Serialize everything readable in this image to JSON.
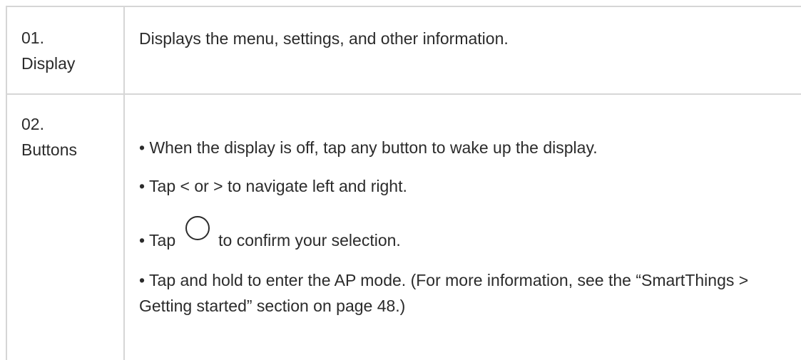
{
  "rows": [
    {
      "number": "01.",
      "name": "Display",
      "description": "Displays the menu, settings, and other information."
    },
    {
      "number": "02.",
      "name": "Buttons",
      "bullets": [
        "• When the display is off, tap any button to wake up the display.",
        "• Tap < or > to navigate left and right.",
        {
          "before_icon": "• Tap",
          "icon": "circle-icon",
          "after_icon": "to confirm your selection."
        },
        "• Tap and hold to enter the AP mode. (For more information, see the “SmartThings > Getting started” section on page 48.)"
      ]
    }
  ]
}
